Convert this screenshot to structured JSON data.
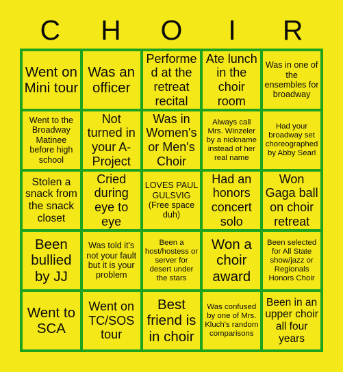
{
  "card": {
    "title_letters": [
      "C",
      "H",
      "O",
      "I",
      "R"
    ],
    "colors": {
      "background": "#f5e818",
      "grid_line": "#1fa31f",
      "cell_background": "#f5e818",
      "text": "#0a0a0a"
    },
    "grid_size": "5x5",
    "cells": [
      {
        "text": "Went on Mini tour",
        "size": "xl"
      },
      {
        "text": "Was an officer",
        "size": "xl"
      },
      {
        "text": "Performed at the retreat recital",
        "size": "lg"
      },
      {
        "text": "Ate lunch in the choir room",
        "size": "lg"
      },
      {
        "text": "Was in one of the ensembles for broadway",
        "size": "sm"
      },
      {
        "text": "Went to the Broadway Matinee before high school",
        "size": "sm"
      },
      {
        "text": "Not turned in your A-Project",
        "size": "lg"
      },
      {
        "text": "Was in Women's or Men's Choir",
        "size": "lg"
      },
      {
        "text": "Always call Mrs. Winzeler by a nickname instead of her real name",
        "size": "xs"
      },
      {
        "text": "Had your broadway set choreographed by Abby Searl",
        "size": "xs"
      },
      {
        "text": "Stolen a snack from the snack closet",
        "size": "md"
      },
      {
        "text": "Cried during eye to eye",
        "size": "lg"
      },
      {
        "text": "LOVES PAUL GULSVIG (Free space duh)",
        "size": "sm"
      },
      {
        "text": "Had an honors concert solo",
        "size": "lg"
      },
      {
        "text": "Won Gaga ball on choir retreat",
        "size": "lg"
      },
      {
        "text": "Been bullied by JJ",
        "size": "xl"
      },
      {
        "text": "Was told it's not your fault but it is your problem",
        "size": "sm"
      },
      {
        "text": "Been a host/hostess or server for desert under the stars",
        "size": "xs"
      },
      {
        "text": "Won a choir award",
        "size": "xl"
      },
      {
        "text": "Been selected for All State show/jazz or Regionals Honors Choir",
        "size": "xs"
      },
      {
        "text": "Went to SCA",
        "size": "xl"
      },
      {
        "text": "Went on TC/SOS tour",
        "size": "lg"
      },
      {
        "text": "Best friend is in choir",
        "size": "xl"
      },
      {
        "text": "Was confused by one of Mrs. Kluch's random comparisons",
        "size": "xs"
      },
      {
        "text": "Been in an upper choir all four years",
        "size": "md"
      }
    ]
  }
}
